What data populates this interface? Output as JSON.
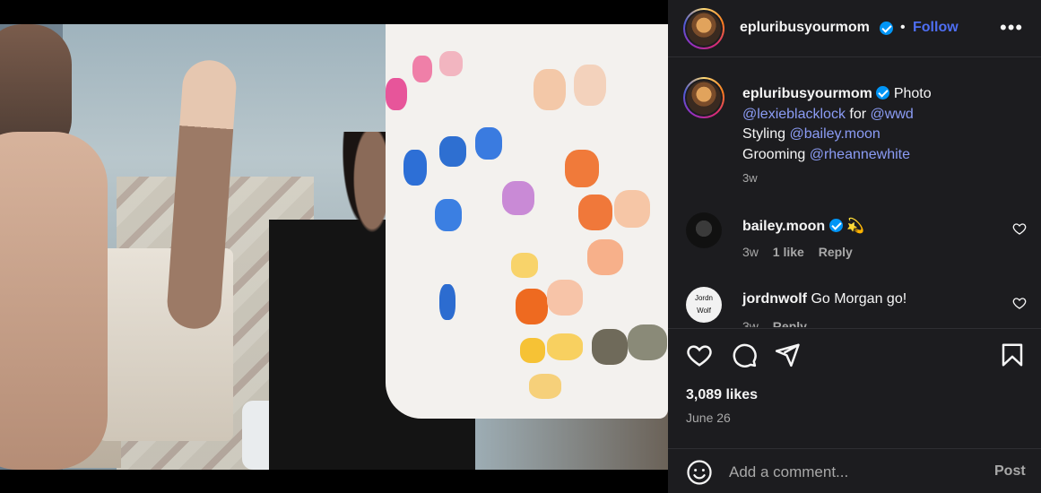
{
  "photo": {
    "alt_icon": "photo-image"
  },
  "header": {
    "username": "epluribusyourmom",
    "separator": "•",
    "follow_label": "Follow",
    "more_icon": "more-horizontal-icon"
  },
  "caption": {
    "username": "epluribusyourmom",
    "line1_text": "Photo",
    "photo_credit": "@lexieblacklock",
    "for_word": "for",
    "publication": "@wwd",
    "styling_label": "Styling",
    "stylist": "@bailey.moon",
    "grooming_label": "Grooming",
    "groomer": "@rheannewhite",
    "timestamp": "3w"
  },
  "comments": [
    {
      "username": "bailey.moon",
      "text": "💫",
      "timestamp": "3w",
      "likes": "1 like",
      "reply_label": "Reply"
    },
    {
      "username": "jordnwolf",
      "text": "Go Morgan go!",
      "timestamp": "3w",
      "reply_label": "Reply",
      "avatar_text": "Jordn Wolf"
    }
  ],
  "actions": {
    "like_icon": "heart-icon",
    "comment_icon": "comment-icon",
    "share_icon": "send-icon",
    "save_icon": "bookmark-icon"
  },
  "likes_count": "3,089 likes",
  "post_date": "June 26",
  "add_comment": {
    "placeholder": "Add a comment...",
    "post_label": "Post",
    "emoji_icon": "emoji-icon"
  },
  "colors": {
    "link": "#8b9cf5",
    "follow": "#4e6ef2",
    "verified": "#0095f6",
    "panel_bg": "#1c1c1f"
  }
}
